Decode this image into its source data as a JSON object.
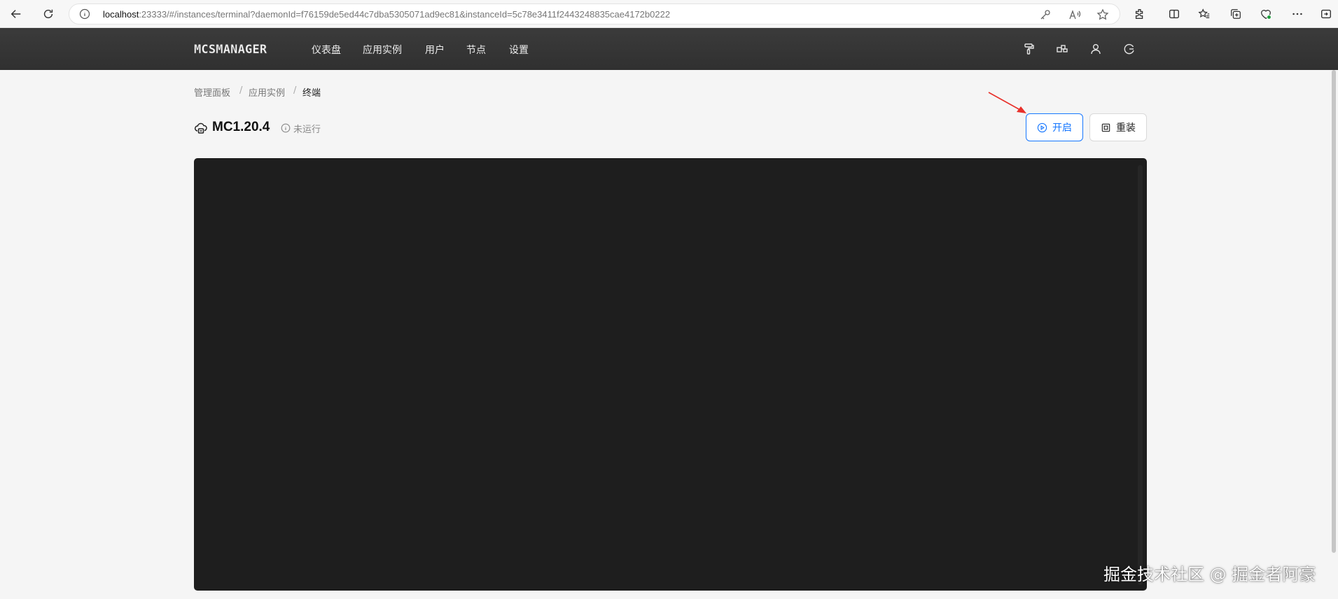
{
  "browser": {
    "url_host": "localhost",
    "url_rest": ":23333/#/instances/terminal?daemonId=f76159de5ed44c7dba5305071ad9ec81&instanceId=5c78e3411f2443248835cae4172b0222",
    "icons": [
      "back-icon",
      "refresh-icon",
      "info-icon",
      "key-icon",
      "read-aloud-icon",
      "favorite-star-icon",
      "extensions-icon",
      "split-screen-icon",
      "favorites-icon",
      "collections-icon",
      "performance-icon",
      "more-icon",
      "sidebar-icon"
    ]
  },
  "navbar": {
    "logo": "MCSMANAGER",
    "items": [
      "仪表盘",
      "应用实例",
      "用户",
      "节点",
      "设置"
    ],
    "icons": [
      "paint-roller-icon",
      "layout-icon",
      "user-icon",
      "logout-icon"
    ]
  },
  "breadcrumb": {
    "items": [
      "管理面板",
      "应用实例",
      "终端"
    ],
    "separator": "/"
  },
  "instance": {
    "name": "MC1.20.4",
    "status": "未运行"
  },
  "actions": {
    "start_label": "开启",
    "reinstall_label": "重装"
  },
  "colors": {
    "accent": "#1677ff",
    "navbar": "#333333",
    "terminal_bg": "#1e1e1e",
    "annotation_arrow": "#e8302a"
  },
  "watermark": "掘金技术社区 @ 掘金者阿豪"
}
